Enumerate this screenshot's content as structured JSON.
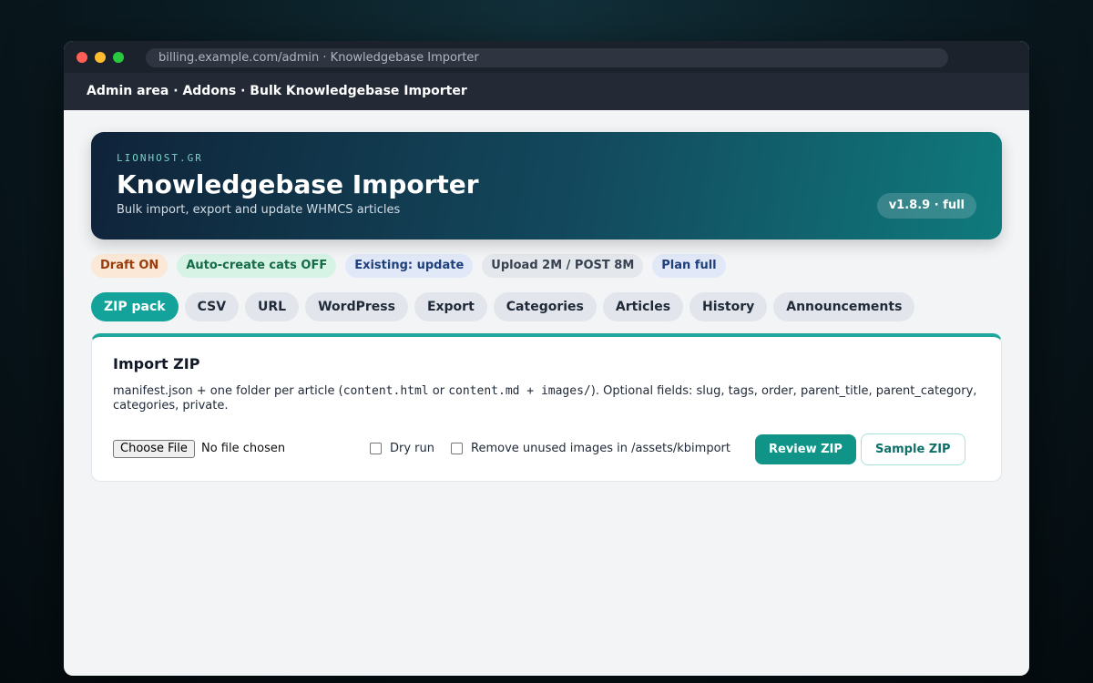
{
  "browser": {
    "url": "billing.example.com/admin · Knowledgebase Importer"
  },
  "admin_bar": {
    "breadcrumb": "Admin area · Addons · Bulk Knowledgebase Importer"
  },
  "hero": {
    "brand": "LIONHOST.GR",
    "title": "Knowledgebase Importer",
    "subtitle": "Bulk import, export and update WHMCS articles",
    "version": "v1.8.9 · full"
  },
  "badges": [
    {
      "label": "Draft ON"
    },
    {
      "label": "Auto-create cats OFF"
    },
    {
      "label": "Existing: update"
    },
    {
      "label": "Upload 2M / POST 8M"
    },
    {
      "label": "Plan full"
    }
  ],
  "tabs": [
    {
      "label": "ZIP pack",
      "active": true
    },
    {
      "label": "CSV"
    },
    {
      "label": "URL"
    },
    {
      "label": "WordPress"
    },
    {
      "label": "Export"
    },
    {
      "label": "Categories"
    },
    {
      "label": "Articles"
    },
    {
      "label": "History"
    },
    {
      "label": "Announcements"
    }
  ],
  "panel": {
    "title": "Import ZIP",
    "desc_prefix": "manifest.json + one folder per article (",
    "desc_code1": "content.html",
    "desc_or": " or ",
    "desc_code2": "content.md + images/",
    "desc_suffix": "). Optional fields: slug, tags, order, parent_title, parent_category, categories, private.",
    "file_button": "Choose File",
    "file_status": "No file chosen",
    "dry_run_label": "Dry run",
    "remove_images_label": "Remove unused images in /assets/kbimport",
    "review_button": "Review ZIP",
    "sample_button": "Sample ZIP"
  },
  "colors": {
    "accent": "#14a39a",
    "hero_start": "#0f2339",
    "hero_end": "#0f7a7c"
  }
}
